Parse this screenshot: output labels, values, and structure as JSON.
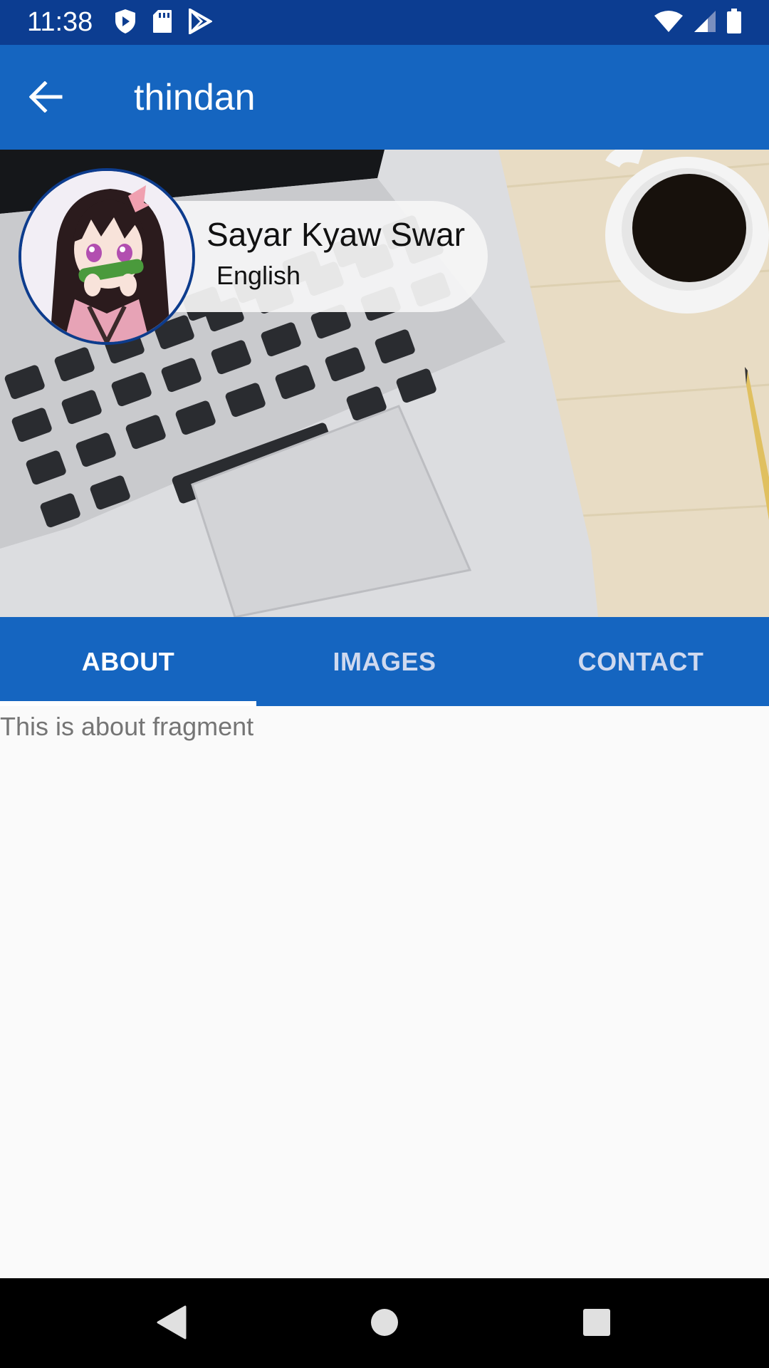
{
  "status_bar": {
    "time": "11:38",
    "left_icons": [
      "shield-play-icon",
      "sd-card-icon",
      "play-store-icon"
    ],
    "right_icons": [
      "wifi-icon",
      "signal-icon",
      "battery-icon"
    ]
  },
  "app_bar": {
    "title": "thindan",
    "back_icon": "arrow-back-icon"
  },
  "profile": {
    "name": "Sayar Kyaw Swar",
    "language": "English",
    "avatar_icon": "anime-avatar-image",
    "cover_image": "laptop-coffee-desk-photo"
  },
  "tabs": [
    {
      "label": "ABOUT",
      "active": true
    },
    {
      "label": "IMAGES",
      "active": false
    },
    {
      "label": "CONTACT",
      "active": false
    }
  ],
  "content": {
    "text": "This is about fragment"
  },
  "nav_bar": {
    "icons": [
      "back-triangle-icon",
      "home-circle-icon",
      "recents-square-icon"
    ]
  },
  "colors": {
    "status_bar": "#0c3d91",
    "primary": "#1565c0",
    "tab_indicator": "#ffffff",
    "avatar_border": "#0d3c8d",
    "content_text": "#757575"
  }
}
